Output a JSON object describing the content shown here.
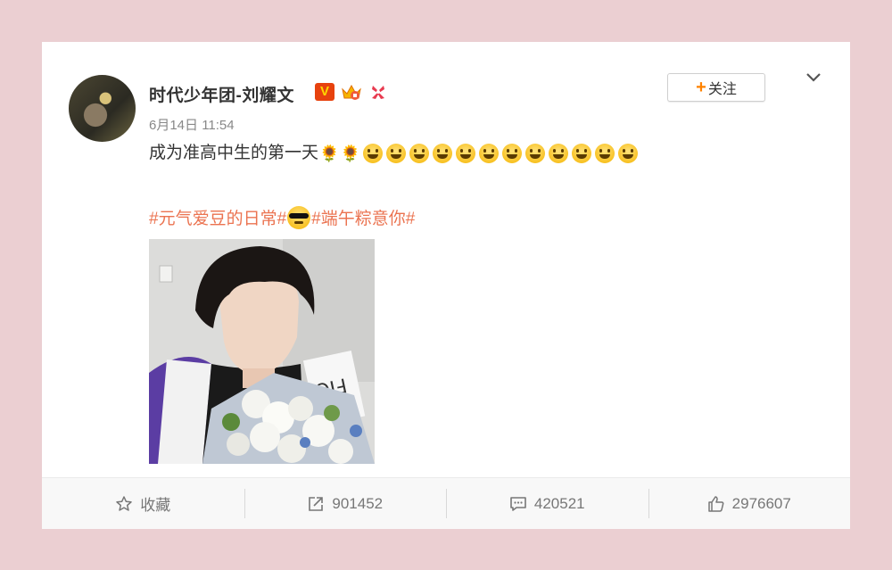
{
  "post": {
    "author": "时代少年团-刘耀文",
    "vip_badge": "V",
    "time": "6月14日 11:54",
    "text": "成为准高中生的第一天",
    "sunflower_count": 2,
    "smile_count": 12,
    "tag1": "#元气爱豆的日常#",
    "tag2": "#端午粽意你#",
    "photo_note_text": "FIO"
  },
  "follow": {
    "plus": "+",
    "label": "关注"
  },
  "actions": {
    "favorite_label": "收藏",
    "repost_count": "901452",
    "comment_count": "420521",
    "like_count": "2976607"
  },
  "colors": {
    "accent_orange": "#ff8200",
    "tag_color": "#eb7350",
    "background": "#ebcfd2"
  }
}
